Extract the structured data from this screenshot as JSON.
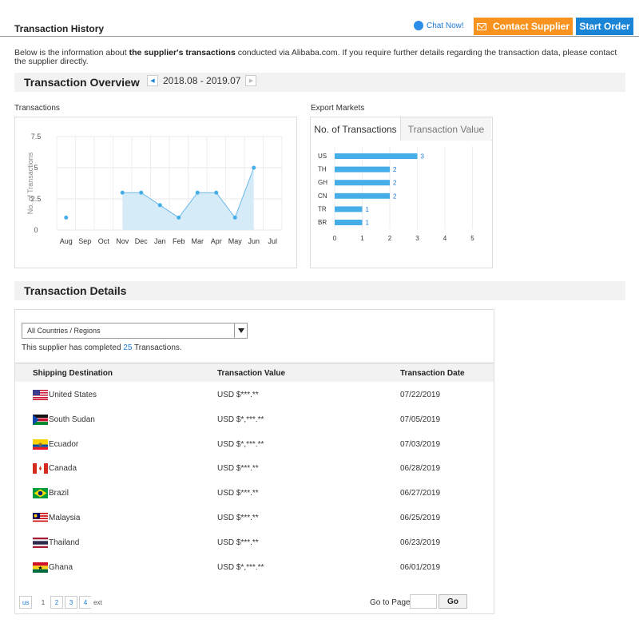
{
  "header": {
    "title": "Transaction History",
    "chat_label": "Chat Now!",
    "contact_label": "Contact Supplier",
    "order_label": "Start Order"
  },
  "intro": {
    "prefix": "Below is the information about ",
    "bold": "the supplier's transactions",
    "suffix": " conducted via Alibaba.com. If you require further details regarding the transaction data, please contact the supplier directly."
  },
  "overview": {
    "title": "Transaction Overview",
    "period": "2018.08 - 2019.07"
  },
  "transactions_label": "Transactions",
  "export_label": "Export Markets",
  "export_tabs": [
    "No. of Transactions",
    "Transaction Value"
  ],
  "details": {
    "title": "Transaction Details",
    "select_value": "All Countries / Regions",
    "completed_prefix": "This supplier has completed ",
    "completed_count": "25",
    "completed_suffix": " Transactions.",
    "columns": [
      "Shipping Destination",
      "Transaction Value",
      "Transaction Date"
    ],
    "rows": [
      {
        "country": "United States",
        "value": "USD $***.**",
        "date": "07/22/2019",
        "flag": "us"
      },
      {
        "country": "South Sudan",
        "value": "USD $*,***.**",
        "date": "07/05/2019",
        "flag": "ss"
      },
      {
        "country": "Ecuador",
        "value": "USD $*,***.**",
        "date": "07/03/2019",
        "flag": "ec"
      },
      {
        "country": "Canada",
        "value": "USD $***.**",
        "date": "06/28/2019",
        "flag": "ca"
      },
      {
        "country": "Brazil",
        "value": "USD $***.**",
        "date": "06/27/2019",
        "flag": "br"
      },
      {
        "country": "Malaysia",
        "value": "USD $***.**",
        "date": "06/25/2019",
        "flag": "my"
      },
      {
        "country": "Thailand",
        "value": "USD $***.**",
        "date": "06/23/2019",
        "flag": "th"
      },
      {
        "country": "Ghana",
        "value": "USD $*,***.**",
        "date": "06/01/2019",
        "flag": "gh"
      }
    ]
  },
  "pager": {
    "prev": "us",
    "pages": [
      "1",
      "2",
      "3",
      "4"
    ],
    "next": "ext",
    "goto_label": "Go to Page",
    "go_label": "Go"
  },
  "colors": {
    "accent": "#1a84d6",
    "orange": "#f7931e",
    "bar": "#45aee8"
  },
  "chart_data": [
    {
      "type": "area",
      "ylabel": "No. of Transactions",
      "categories": [
        "Aug",
        "Sep",
        "Oct",
        "Nov",
        "Dec",
        "Jan",
        "Feb",
        "Mar",
        "Apr",
        "May",
        "Jun",
        "Jul"
      ],
      "yticks": [
        "0",
        "2.5",
        "5",
        "7.5"
      ],
      "ylim": [
        0,
        7.5
      ],
      "values": [
        1,
        null,
        null,
        3,
        3,
        2,
        1,
        3,
        3,
        1,
        5,
        null
      ],
      "grid": true
    },
    {
      "type": "bar",
      "orientation": "horizontal",
      "categories": [
        "US",
        "TH",
        "GH",
        "CN",
        "TR",
        "BR"
      ],
      "values": [
        3,
        2,
        2,
        2,
        1,
        1
      ],
      "xticks": [
        "0",
        "1",
        "2",
        "3",
        "4",
        "5"
      ],
      "xlim": [
        0,
        5
      ],
      "grid": true
    }
  ]
}
